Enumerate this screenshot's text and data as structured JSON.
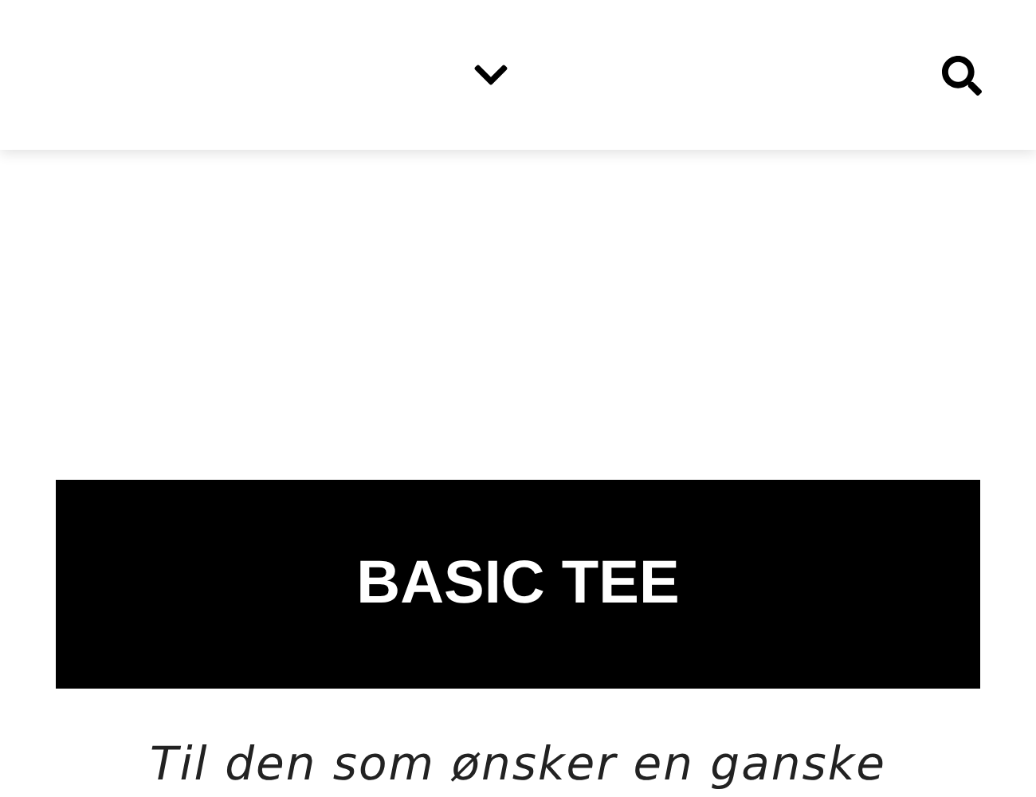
{
  "header": {
    "menu": {
      "expanded": false
    }
  },
  "banner": {
    "title": "BASIC TEE"
  },
  "intro": "Til den som ønsker en ganske"
}
